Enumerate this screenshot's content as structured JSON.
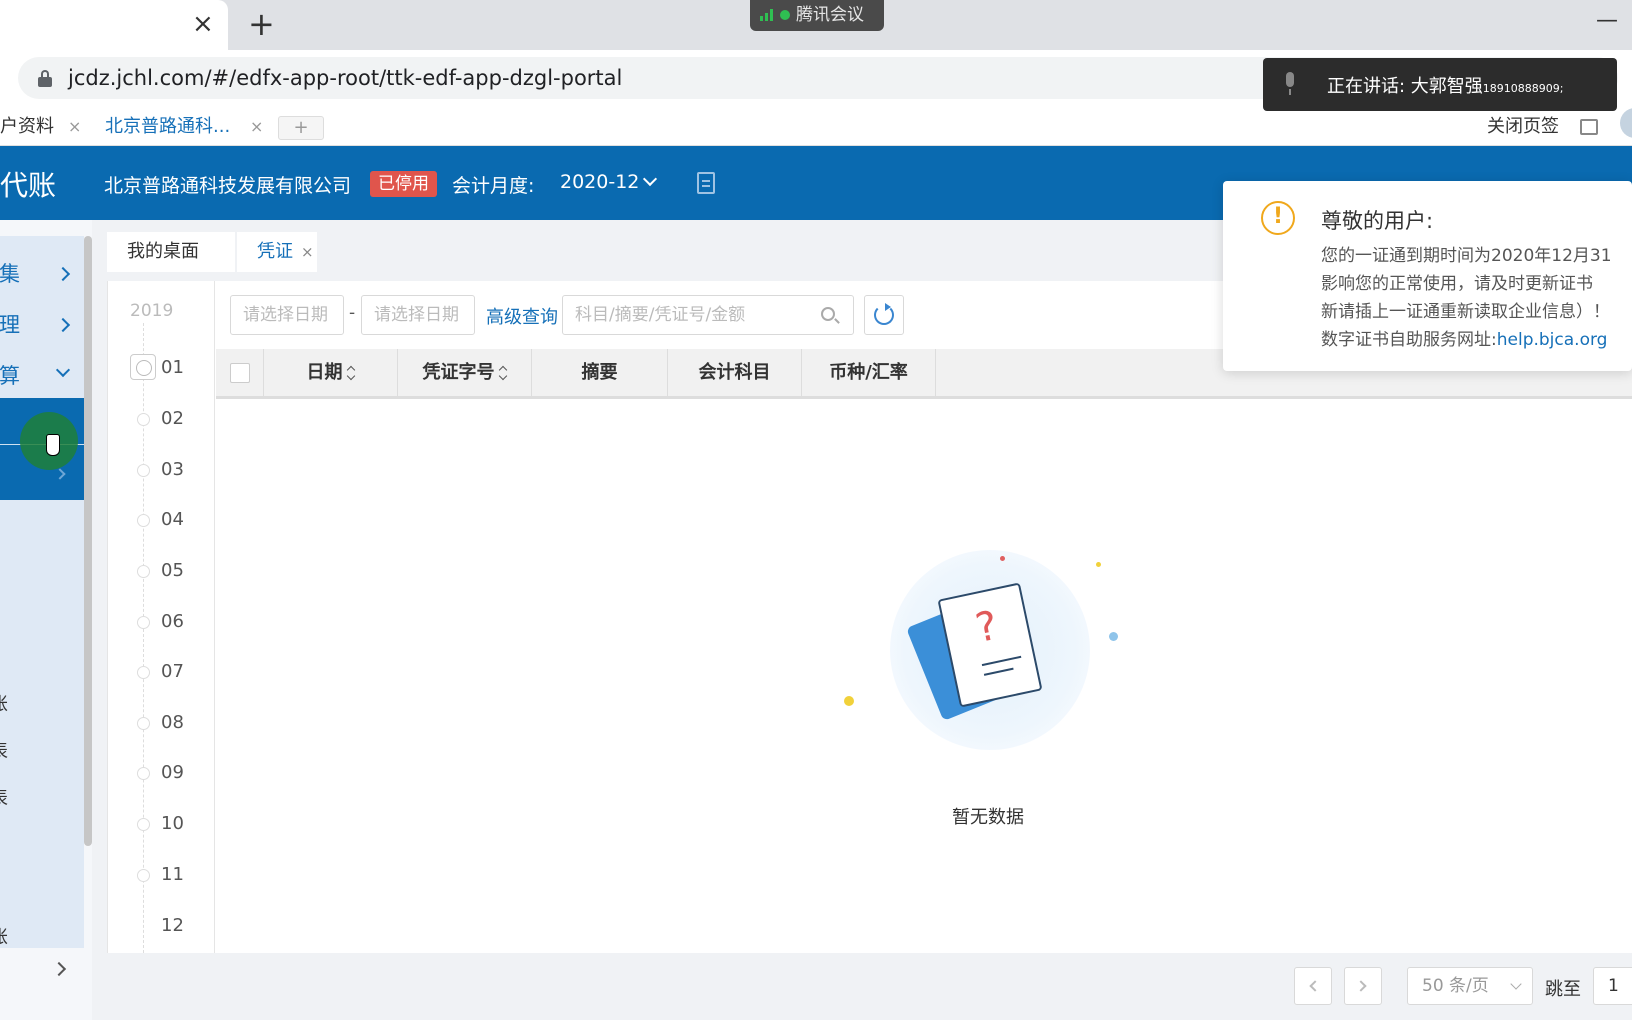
{
  "browser": {
    "new_tab_symbol": "+",
    "close_symbol": "×",
    "url": "jcdz.jchl.com/#/edfx-app-root/ttk-edf-app-dzgl-portal",
    "meeting_app": "腾讯会议",
    "minimize_symbol": "—"
  },
  "speaking_toast": {
    "text": "正在讲话: 大郭智强",
    "number": "18910888909;"
  },
  "app_tabs": {
    "tab1_label": "户资料",
    "tab2_label": "北京普路通科...",
    "close_symbol": "×",
    "add_symbol": "+",
    "close_pages": "关闭页签"
  },
  "header": {
    "logo": "代账",
    "company": "北京普路通科技发展有限公司",
    "status": "已停用",
    "period_label": "会计月度:",
    "period_value": "2020-12"
  },
  "sidebar": {
    "items": [
      {
        "label": "采集"
      },
      {
        "label": "处理"
      },
      {
        "label": "结算"
      }
    ],
    "sub_items": [
      "账",
      "表",
      "表",
      "账"
    ]
  },
  "main_tabs": {
    "desktop": "我的桌面",
    "voucher": "凭证",
    "close_symbol": "×"
  },
  "timeline": {
    "year": "2019",
    "months": [
      "01",
      "02",
      "03",
      "04",
      "05",
      "06",
      "07",
      "08",
      "09",
      "10",
      "11",
      "12"
    ]
  },
  "filters": {
    "date_start_placeholder": "请选择日期",
    "date_end_placeholder": "请选择日期",
    "dash": "-",
    "advanced_query": "高级查询",
    "search_placeholder": "科目/摘要/凭证号/金额"
  },
  "table": {
    "columns": [
      "日期",
      "凭证字号",
      "摘要",
      "会计科目",
      "币种/汇率"
    ]
  },
  "empty_state": {
    "text": "暂无数据",
    "question_mark": "?"
  },
  "notice": {
    "icon_symbol": "!",
    "title": "尊敬的用户:",
    "line1": "您的一证通到期时间为2020年12月31",
    "line2": "影响您的正常使用，请及时更新证书",
    "line3": "新请插上一证通重新读取企业信息）！",
    "line4_prefix": "数字证书自助服务网址:",
    "line4_link": "help.bjca.org"
  },
  "pagination": {
    "page_size": "50 条/页",
    "goto_label": "跳至",
    "goto_value": "1"
  }
}
